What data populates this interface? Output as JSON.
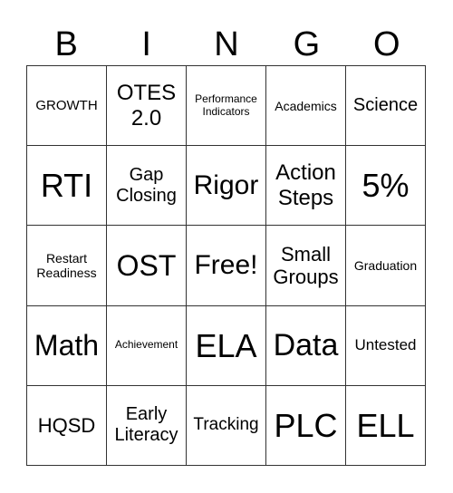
{
  "header": [
    "B",
    "I",
    "N",
    "G",
    "O"
  ],
  "cells": [
    "GROWTH",
    "OTES 2.0",
    "Performance Indicators",
    "Academics",
    "Science",
    "RTI",
    "Gap Closing",
    "Rigor",
    "Action Steps",
    "5%",
    "Restart Readiness",
    "OST",
    "Free!",
    "Small Groups",
    "Graduation",
    "Math",
    "Achievement",
    "ELA",
    "Data",
    "Untested",
    "HQSD",
    "Early Literacy",
    "Tracking",
    "PLC",
    "ELL"
  ]
}
